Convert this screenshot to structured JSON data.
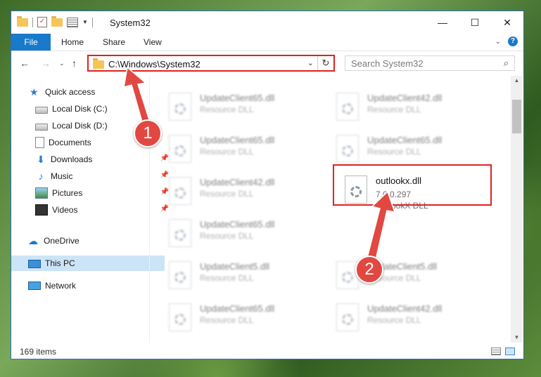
{
  "window": {
    "title": "System32",
    "quick_access_toolbar": [
      "folder-icon",
      "properties-check-icon",
      "new-folder-icon",
      "customize-dropdown"
    ]
  },
  "ribbon": {
    "file_tab": "File",
    "tabs": [
      "Home",
      "Share",
      "View"
    ],
    "help_label": "?"
  },
  "address": {
    "path": "C:\\Windows\\System32",
    "search_placeholder": "Search System32"
  },
  "nav": {
    "items": [
      {
        "label": "Quick access",
        "icon": "star-icon"
      },
      {
        "label": "Local Disk (C:)",
        "icon": "drive-icon"
      },
      {
        "label": "Local Disk (D:)",
        "icon": "drive-icon"
      },
      {
        "label": "Documents",
        "icon": "documents-icon"
      },
      {
        "label": "Downloads",
        "icon": "download-icon"
      },
      {
        "label": "Music",
        "icon": "music-icon"
      },
      {
        "label": "Pictures",
        "icon": "pictures-icon"
      },
      {
        "label": "Videos",
        "icon": "videos-icon"
      },
      {
        "label": "OneDrive",
        "icon": "cloud-icon"
      },
      {
        "label": "This PC",
        "icon": "computer-icon",
        "selected": true
      },
      {
        "label": "Network",
        "icon": "network-icon"
      }
    ]
  },
  "files": {
    "left": [
      {
        "name": "UpdateClient65.dll",
        "type": "Resource DLL"
      },
      {
        "name": "UpdateClient65.dll",
        "type": "Resource DLL"
      },
      {
        "name": "UpdateClient42.dll",
        "type": "Resource DLL"
      },
      {
        "name": "UpdateClient65.dll",
        "type": "Resource DLL"
      },
      {
        "name": "UpdateClient5.dll",
        "type": "Resource DLL"
      },
      {
        "name": "UpdateClient65.dll",
        "type": "Resource DLL"
      }
    ],
    "right": [
      {
        "name": "UpdateClient42.dll",
        "type": "Resource DLL"
      },
      {
        "name": "UpdateClient65.dll",
        "type": "Resource DLL"
      },
      {
        "name": "UpdateClient5.dll",
        "type": "Resource DLL"
      },
      {
        "name": "UpdateClient42.dll",
        "type": "Resource DLL"
      }
    ],
    "highlighted": {
      "name": "outlookx.dll",
      "version": "7.0.0.297",
      "description": "OutlookX DLL"
    }
  },
  "status": {
    "item_count": "169 items"
  },
  "annotations": {
    "step1": "1",
    "step2": "2",
    "color": "#e24842"
  }
}
